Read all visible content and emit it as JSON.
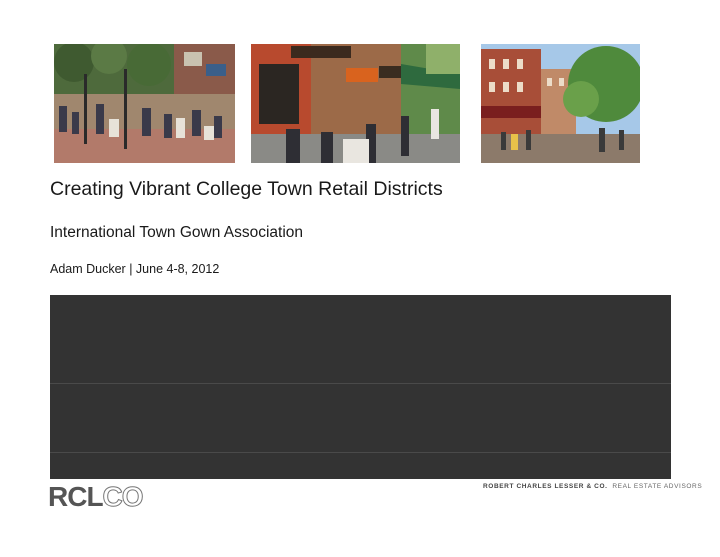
{
  "photos": [
    {
      "name": "pedestrian-mall-plaza-photo"
    },
    {
      "name": "outdoor-cafe-street-photo"
    },
    {
      "name": "downtown-main-street-photo"
    }
  ],
  "title": "Creating Vibrant College Town Retail Districts",
  "subtitle": "International Town Gown Association",
  "byline": "Adam Ducker  | June 4-8, 2012",
  "logo": {
    "solid_text": "RCL",
    "outline_text": "CO"
  },
  "tagline": {
    "firm": "ROBERT CHARLES LESSER & CO.",
    "advisors": "REAL ESTATE ADVISORS"
  },
  "colors": {
    "band": "#333333",
    "logo_gray": "#555555"
  }
}
